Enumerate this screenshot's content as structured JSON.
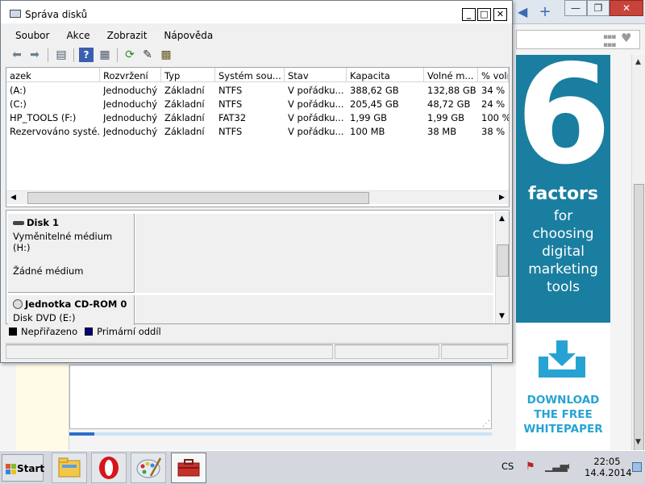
{
  "window": {
    "title": "Správa disků",
    "menu": [
      "Soubor",
      "Akce",
      "Zobrazit",
      "Nápověda"
    ],
    "controls": {
      "minimize": "_",
      "maximize": "□",
      "close": "✕"
    }
  },
  "volumes": {
    "columns": [
      "azek",
      "Rozvržení",
      "Typ",
      "Systém sou...",
      "Stav",
      "Kapacita",
      "Volné m...",
      "% volr"
    ],
    "rows": [
      [
        "(A:)",
        "Jednoduchý",
        "Základní",
        "NTFS",
        "V pořádku...",
        "388,62 GB",
        "132,88 GB",
        "34 %"
      ],
      [
        "(C:)",
        "Jednoduchý",
        "Základní",
        "NTFS",
        "V pořádku...",
        "205,45 GB",
        "48,72 GB",
        "24 %"
      ],
      [
        "HP_TOOLS (F:)",
        "Jednoduchý",
        "Základní",
        "FAT32",
        "V pořádku...",
        "1,99 GB",
        "1,99 GB",
        "100 %"
      ],
      [
        "Rezervováno systé...",
        "Jednoduchý",
        "Základní",
        "NTFS",
        "V pořádku...",
        "100 MB",
        "38 MB",
        "38 %"
      ]
    ]
  },
  "disks": [
    {
      "name": "Disk 1",
      "line1": "Vyměnitelné médium (H:)",
      "line2": "Žádné médium"
    },
    {
      "name": "Jednotka CD-ROM 0",
      "line1": "Disk DVD (E:)"
    }
  ],
  "legend": [
    {
      "label": "Nepřiřazeno",
      "color": "#000000"
    },
    {
      "label": "Primární oddíl",
      "color": "#000080"
    }
  ],
  "ad": {
    "number": "6",
    "word": "factors",
    "lines": [
      "for",
      "choosing",
      "digital",
      "marketing",
      "tools"
    ],
    "cta": [
      "DOWNLOAD",
      "THE FREE",
      "WHITEPAPER"
    ],
    "bg_color": "#1a7ea0",
    "cta_color": "#27a3d3"
  },
  "browser": {
    "tab_arrow": "◀",
    "new_tab": "+",
    "win_min": "—",
    "win_max": "❐",
    "win_close": "✕"
  },
  "page": {
    "progress": 0.06
  },
  "taskbar": {
    "start_label": "Start",
    "lang": "CS",
    "time": "22:05",
    "date": "14.4.2014"
  }
}
